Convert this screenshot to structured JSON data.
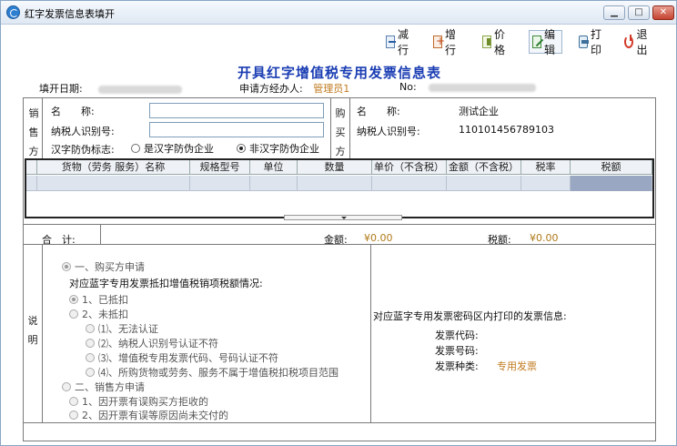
{
  "window": {
    "title": "红字发票信息表填开"
  },
  "toolbar": {
    "reduce": "减行",
    "add": "增行",
    "price": "价格",
    "edit": "编辑",
    "print": "打印",
    "exit": "退出"
  },
  "doc_title": "开具红字增值税专用发票信息表",
  "header": {
    "fill_date_label": "填开日期:",
    "applicant_label": "申请方经办人:",
    "applicant_value": "管理员1",
    "no_label": "No:"
  },
  "seller": {
    "section": "销售方",
    "name_label": "名　　称:",
    "tax_id_label": "纳税人识别号:",
    "anti_fake_label": "汉字防伪标志:",
    "opt_yes": "是汉字防伪企业",
    "opt_no": "非汉字防伪企业",
    "name_value": "",
    "tax_id_value": ""
  },
  "buyer": {
    "section": "购买方",
    "name_label": "名　　称:",
    "name_value": "测试企业",
    "tax_id_label": "纳税人识别号:",
    "tax_id_value": "110101456789103"
  },
  "grid": {
    "columns": [
      "货物（劳务 服务）名称",
      "规格型号",
      "单位",
      "数量",
      "单价（不含税）",
      "金额（不含税）",
      "税率",
      "税额"
    ]
  },
  "totals": {
    "label": "合　计:",
    "amount_label": "金额:",
    "amount_value": "¥0.00",
    "tax_label": "税额:",
    "tax_value": "¥0.00"
  },
  "remarks": {
    "section": "说明",
    "buyer_apply": "一、购买方申请",
    "deduct_question": "对应蓝字专用发票抵扣增值税销项税额情况:",
    "deducted": "1、已抵扣",
    "not_deducted": "2、未抵扣",
    "r1": "⑴、无法认证",
    "r2": "⑵、纳税人识别号认证不符",
    "r3": "⑶、增值税专用发票代码、号码认证不符",
    "r4": "⑷、所购货物或劳务、服务不属于增值税扣税项目范围",
    "seller_apply": "二、销售方申请",
    "s1": "1、因开票有误购买方拒收的",
    "s2": "2、因开票有误等原因尚未交付的",
    "invoice_info_title": "对应蓝字专用发票密码区内打印的发票信息:",
    "code_label": "发票代码:",
    "number_label": "发票号码:",
    "type_label": "发票种类:",
    "type_value": "专用发票"
  }
}
